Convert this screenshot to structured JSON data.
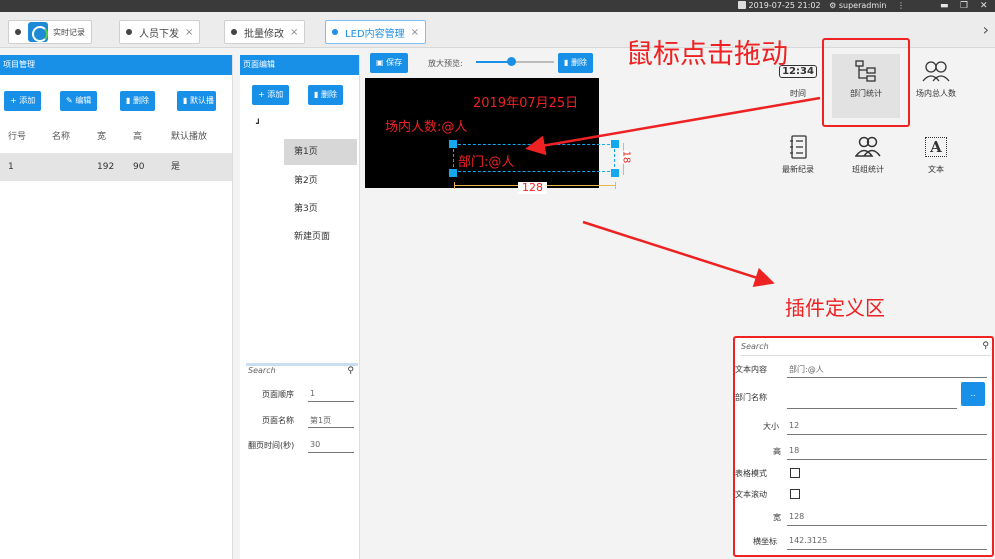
{
  "titlebar": {
    "datetime": "2019-07-25 21:02",
    "user": "superadmin",
    "icons": [
      "user-icon",
      "menu-icon",
      "minimize-icon",
      "restore-icon",
      "close-icon"
    ]
  },
  "tabs": [
    {
      "label": "实时记录",
      "closable": false,
      "active": false,
      "has_logo": true
    },
    {
      "label": "人员下发",
      "closable": true,
      "active": false
    },
    {
      "label": "批量修改",
      "closable": true,
      "active": false
    },
    {
      "label": "LED内容管理",
      "closable": true,
      "active": true
    }
  ],
  "tab_close": "×",
  "tab_scroll_right": "›",
  "project_panel": {
    "header": "项目管理",
    "buttons": {
      "add": "+ 添加",
      "edit": "编辑",
      "delete": "删除",
      "default": "默认播"
    },
    "columns": [
      "行号",
      "名称",
      "宽",
      "高",
      "默认播放"
    ],
    "rows": [
      {
        "no": "1",
        "name": "",
        "width": "192",
        "height": "90",
        "default": "是"
      }
    ]
  },
  "page_panel": {
    "header": "页面编辑",
    "buttons": {
      "add": "+ 添加",
      "delete": "删除"
    },
    "tree_toggle": "┛",
    "pages": [
      "第1页",
      "第2页",
      "第3页",
      "新建页面"
    ],
    "selected_page": "第1页",
    "search_placeholder": "Search",
    "props": [
      {
        "label": "页面顺序",
        "value": "1"
      },
      {
        "label": "页面名称",
        "value": "第1页"
      },
      {
        "label": "翻页时间(秒)",
        "value": "30"
      }
    ]
  },
  "editor": {
    "save": "保存",
    "zoom_label": "放大预览:",
    "zoom_level": 0.45,
    "delete": "删除",
    "canvas_texts": {
      "date": "2019年07月25日",
      "visitors": "场内人数:@人",
      "dept": "部门:@人"
    },
    "selection": {
      "width_label": "128",
      "height_label": "18"
    }
  },
  "annotations": {
    "drag_hint": "鼠标点击拖动",
    "plugin_area": "插件定义区"
  },
  "plugins": [
    {
      "label": "时间",
      "icon": "clock-icon",
      "icon_text": "12:34",
      "selected": false
    },
    {
      "label": "部门统计",
      "icon": "org-chart-icon",
      "selected": true
    },
    {
      "label": "场内总人数",
      "icon": "users-icon",
      "selected": false
    },
    {
      "label": "最新纪录",
      "icon": "record-list-icon",
      "selected": false
    },
    {
      "label": "班组统计",
      "icon": "team-icon",
      "selected": false
    },
    {
      "label": "文本",
      "icon": "text-icon",
      "icon_text": "A",
      "selected": false
    }
  ],
  "properties": {
    "search_placeholder": "Search",
    "fields": [
      {
        "label": "文本内容",
        "value": "部门:@人",
        "type": "text"
      },
      {
        "label": "部门名称",
        "value": "",
        "type": "picker",
        "picker_label": ".."
      },
      {
        "label": "大小",
        "value": "12",
        "type": "text"
      },
      {
        "label": "高",
        "value": "18",
        "type": "text"
      },
      {
        "label": "表格模式",
        "value": "",
        "type": "checkbox",
        "checked": false
      },
      {
        "label": "文本滚动",
        "value": "",
        "type": "checkbox",
        "checked": false
      },
      {
        "label": "宽",
        "value": "128",
        "type": "text"
      },
      {
        "label": "横坐标",
        "value": "142.3125",
        "type": "text"
      }
    ]
  },
  "colors": {
    "accent": "#1890e8",
    "annotation_red": "#ee2222",
    "canvas_bg": "#000000",
    "selection": "#14a8ee",
    "dimension": "#e8b64a"
  }
}
